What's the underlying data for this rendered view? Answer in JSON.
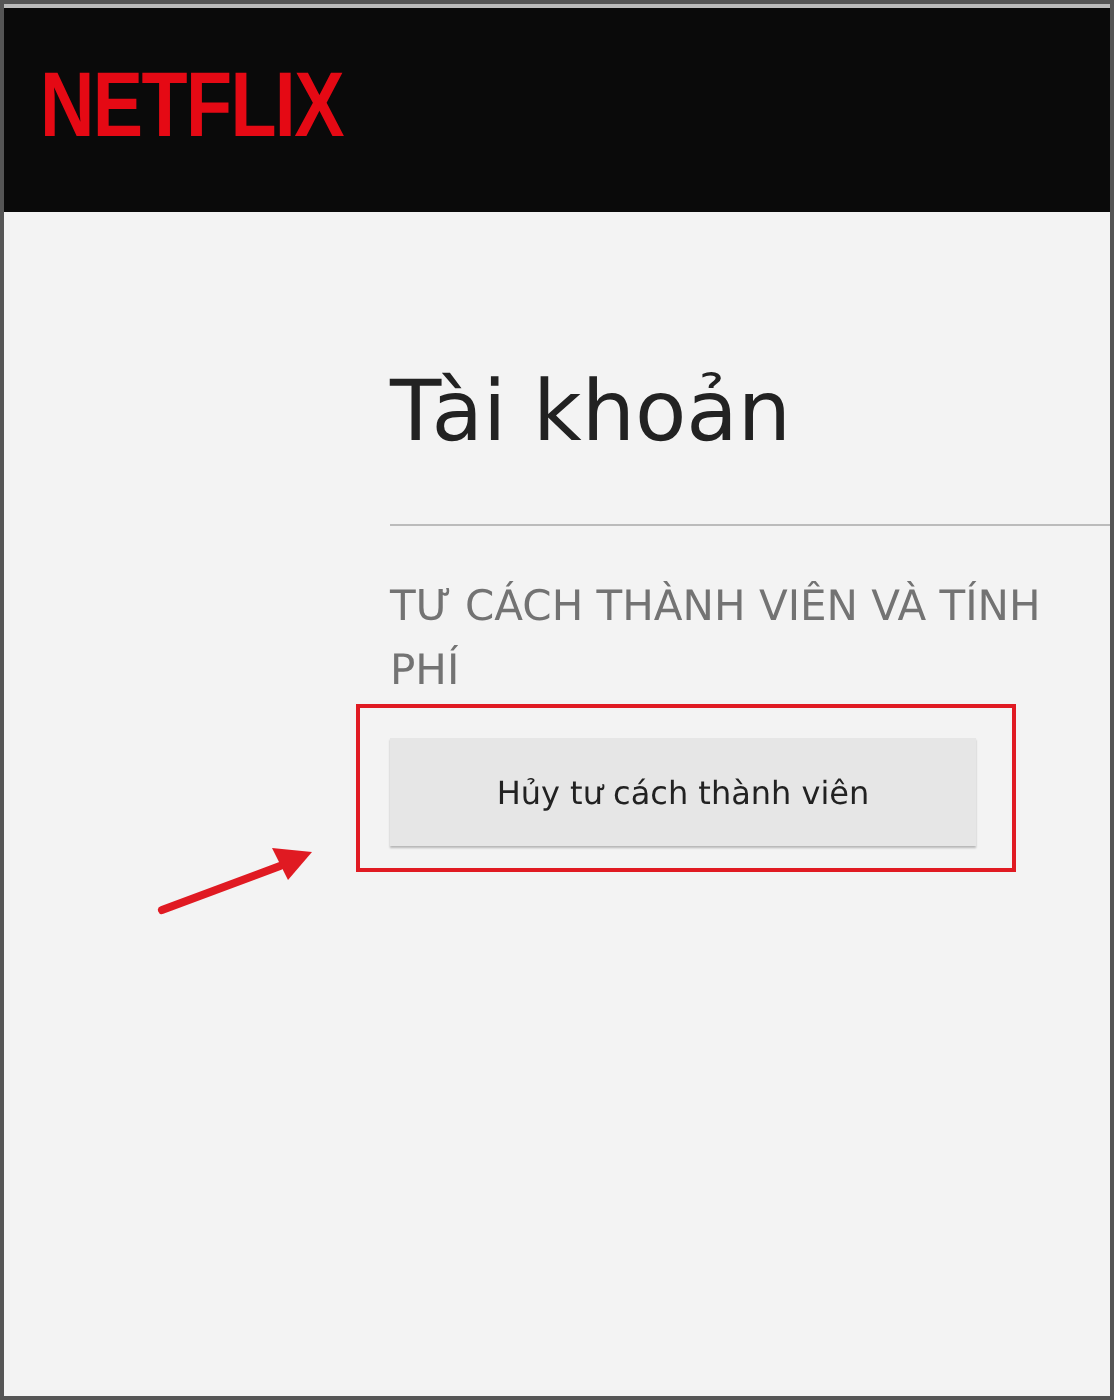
{
  "header": {
    "logo": "NETFLIX"
  },
  "page_title": "Tài khoản",
  "section": {
    "heading": "TƯ CÁCH THÀNH VIÊN VÀ TÍNH PHÍ",
    "button": "Hủy tư cách thành viên"
  }
}
